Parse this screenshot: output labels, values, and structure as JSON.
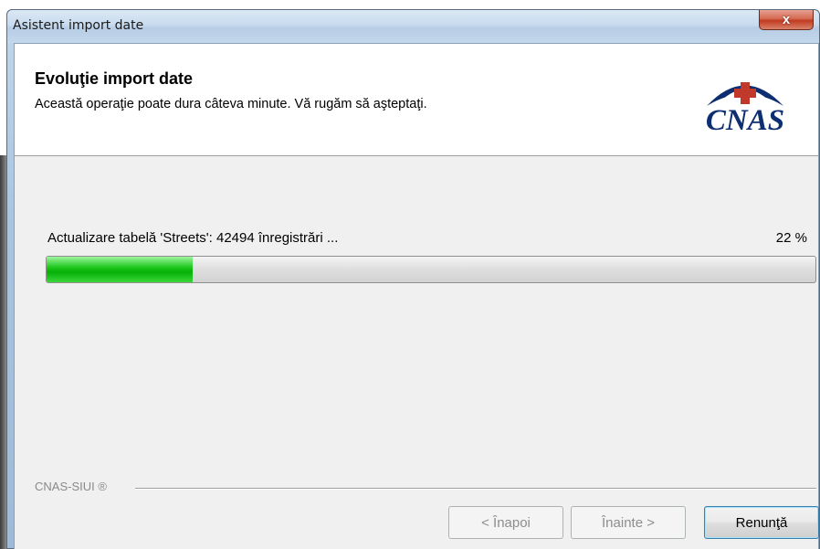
{
  "window": {
    "title": "Asistent import date",
    "close_label": "x"
  },
  "header": {
    "title": "Evoluţie import date",
    "subtitle": "Această operaţie poate dura câteva minute. Vă rugăm să aşteptaţi.",
    "logo_text": "CNAS"
  },
  "progress": {
    "label": "Actualizare tabelă 'Streets': 42494 înregistrări ...",
    "percent_text": "22 %",
    "percent": 0.19,
    "fill_color": "#0fb80f"
  },
  "footer": {
    "brand": "CNAS-SIUI ®"
  },
  "buttons": {
    "back_label": "< Înapoi",
    "next_label": "Înainte >",
    "cancel_label": "Renunţă"
  },
  "colors": {
    "brand_navy": "#0d2f72",
    "logo_red": "#c0392b"
  }
}
